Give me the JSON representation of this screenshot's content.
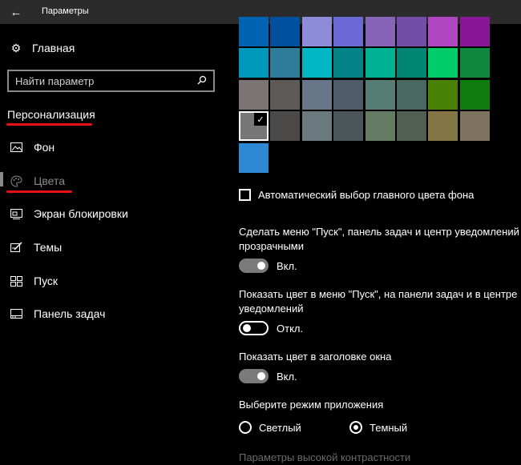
{
  "window": {
    "title": "Параметры"
  },
  "sidebar": {
    "home_label": "Главная",
    "search_placeholder": "Найти параметр",
    "section_title": "Персонализация",
    "items": [
      {
        "label": "Фон",
        "icon": "image-icon"
      },
      {
        "label": "Цвета",
        "icon": "palette-icon",
        "active": true
      },
      {
        "label": "Экран блокировки",
        "icon": "lock-screen-icon"
      },
      {
        "label": "Темы",
        "icon": "themes-icon"
      },
      {
        "label": "Пуск",
        "icon": "start-icon"
      },
      {
        "label": "Панель задач",
        "icon": "taskbar-icon"
      }
    ]
  },
  "colors": {
    "swatch_rows": [
      [
        "#0063b1",
        "#0050a0",
        "#8e8cd8",
        "#6b69d6",
        "#8764b8",
        "#744da9",
        "#b146c2",
        "#881798"
      ],
      [
        "#0099bc",
        "#2d7d9a",
        "#00b7c3",
        "#038387",
        "#00b294",
        "#018574",
        "#00cc6a",
        "#10893e"
      ],
      [
        "#7a7574",
        "#5d5a58",
        "#68768a",
        "#515c6b",
        "#567c73",
        "#486860",
        "#498205",
        "#107c10"
      ],
      [
        "#767676",
        "#4c4a48",
        "#69797e",
        "#4a5459",
        "#647c64",
        "#525e54",
        "#847545",
        "#7e735f"
      ],
      [
        "#2d88d4"
      ]
    ],
    "selected": {
      "row": 3,
      "col": 0
    }
  },
  "settings": {
    "auto_color_label": "Автоматический выбор главного цвета фона",
    "auto_color_checked": false,
    "transparency_label": "Сделать меню \"Пуск\", панель задач и центр уведомлений прозрачными",
    "transparency_state": "Вкл.",
    "transparency_on": true,
    "show_color_start_label": "Показать цвет в меню \"Пуск\", на панели задач и в центре уведомлений",
    "show_color_start_state": "Откл.",
    "show_color_start_on": false,
    "show_color_title_label": "Показать цвет в заголовке окна",
    "show_color_title_state": "Вкл.",
    "show_color_title_on": true,
    "app_mode_label": "Выберите режим приложения",
    "mode_light": "Светлый",
    "mode_dark": "Темный",
    "selected_mode": "Темный",
    "high_contrast_link": "Параметры высокой контрастности"
  },
  "annotation_color": "#e81010"
}
